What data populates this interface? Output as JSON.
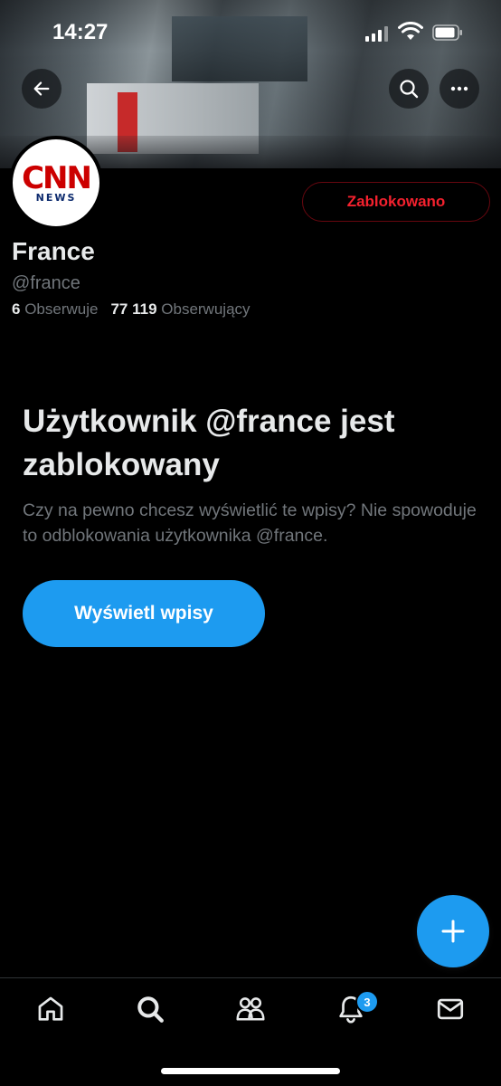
{
  "status_bar": {
    "time": "14:27"
  },
  "header": {
    "back_icon": "arrow-left-icon",
    "search_icon": "search-icon",
    "more_icon": "more-horizontal-icon"
  },
  "profile": {
    "avatar_logo": "CNN",
    "avatar_sub": "NEWS",
    "blocked_button": "Zablokowano",
    "display_name": "France",
    "handle": "@france",
    "following_count": "6",
    "following_label": "Obserwuje",
    "followers_count": "77 119",
    "followers_label": "Obserwujący"
  },
  "blocked_notice": {
    "title": "Użytkownik @france jest zablokowany",
    "description": "Czy na pewno chcesz wyświetlić te wpisy? Nie spowoduje to odblokowania użytkownika @france.",
    "view_button": "Wyświetl wpisy"
  },
  "fab": {
    "icon": "plus-icon"
  },
  "tabbar": {
    "items": [
      {
        "name": "home",
        "icon": "home-icon"
      },
      {
        "name": "search",
        "icon": "search-icon"
      },
      {
        "name": "communities",
        "icon": "communities-icon"
      },
      {
        "name": "notifications",
        "icon": "bell-icon",
        "badge": "3"
      },
      {
        "name": "messages",
        "icon": "mail-icon"
      }
    ]
  },
  "colors": {
    "accent": "#1d9bf0",
    "blocked_red": "#f4212e",
    "background": "#000000",
    "secondary_text": "#71767b"
  }
}
